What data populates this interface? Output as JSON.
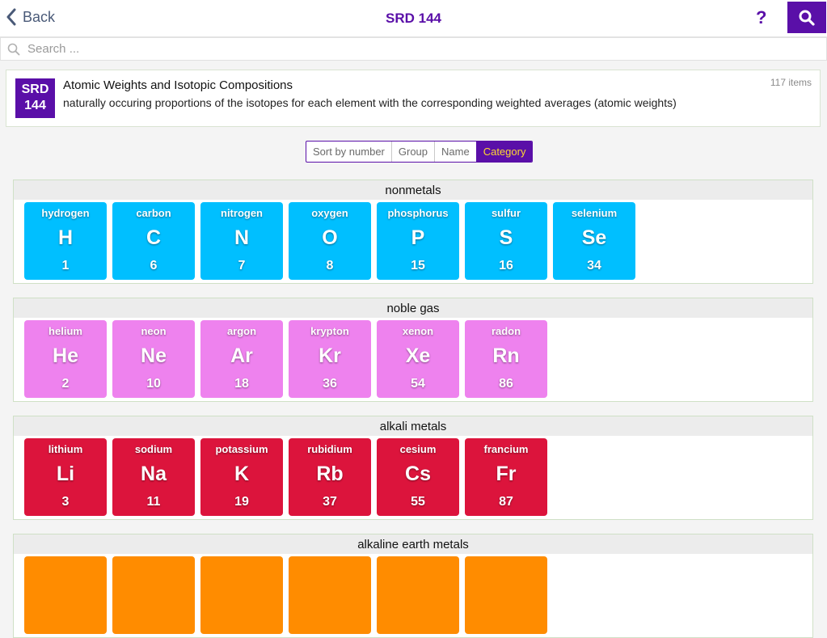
{
  "header": {
    "back_label": "Back",
    "title": "SRD 144",
    "help_label": "?"
  },
  "search": {
    "placeholder": "Search ..."
  },
  "database": {
    "logo_line1": "SRD",
    "logo_line2": "144",
    "title": "Atomic Weights and Isotopic Compositions",
    "description": "naturally occuring proportions of the isotopes for each element with the corresponding weighted averages (atomic weights)",
    "count": "117 items"
  },
  "sort_options": [
    {
      "label": "Sort by number",
      "active": false
    },
    {
      "label": "Group",
      "active": false
    },
    {
      "label": "Name",
      "active": false
    },
    {
      "label": "Category",
      "active": true
    }
  ],
  "colors": {
    "accent": "#5a0fa8",
    "accent_text": "#ffd830",
    "nonmetals": "#00bfff",
    "noble_gas": "#ee82ee",
    "alkali_metals": "#dc143c",
    "alkaline_earth_metals": "#ff8c00"
  },
  "groups": [
    {
      "name": "nonmetals",
      "color": "#00bfff",
      "elements": [
        {
          "name": "hydrogen",
          "symbol": "H",
          "number": "1"
        },
        {
          "name": "carbon",
          "symbol": "C",
          "number": "6"
        },
        {
          "name": "nitrogen",
          "symbol": "N",
          "number": "7"
        },
        {
          "name": "oxygen",
          "symbol": "O",
          "number": "8"
        },
        {
          "name": "phosphorus",
          "symbol": "P",
          "number": "15"
        },
        {
          "name": "sulfur",
          "symbol": "S",
          "number": "16"
        },
        {
          "name": "selenium",
          "symbol": "Se",
          "number": "34"
        }
      ]
    },
    {
      "name": "noble gas",
      "color": "#ee82ee",
      "elements": [
        {
          "name": "helium",
          "symbol": "He",
          "number": "2"
        },
        {
          "name": "neon",
          "symbol": "Ne",
          "number": "10"
        },
        {
          "name": "argon",
          "symbol": "Ar",
          "number": "18"
        },
        {
          "name": "krypton",
          "symbol": "Kr",
          "number": "36"
        },
        {
          "name": "xenon",
          "symbol": "Xe",
          "number": "54"
        },
        {
          "name": "radon",
          "symbol": "Rn",
          "number": "86"
        }
      ]
    },
    {
      "name": "alkali metals",
      "color": "#dc143c",
      "elements": [
        {
          "name": "lithium",
          "symbol": "Li",
          "number": "3"
        },
        {
          "name": "sodium",
          "symbol": "Na",
          "number": "11"
        },
        {
          "name": "potassium",
          "symbol": "K",
          "number": "19"
        },
        {
          "name": "rubidium",
          "symbol": "Rb",
          "number": "37"
        },
        {
          "name": "cesium",
          "symbol": "Cs",
          "number": "55"
        },
        {
          "name": "francium",
          "symbol": "Fr",
          "number": "87"
        }
      ]
    },
    {
      "name": "alkaline earth metals",
      "color": "#ff8c00",
      "elements": []
    }
  ]
}
